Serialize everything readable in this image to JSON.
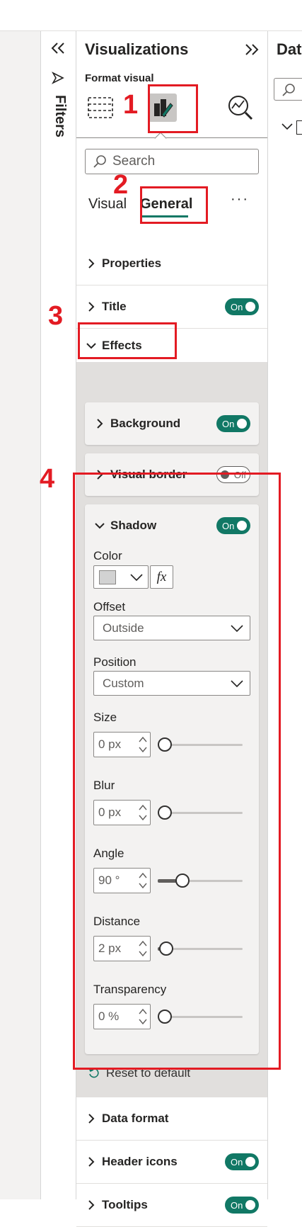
{
  "filters": {
    "label": "Filters",
    "collapse_icon": "double-chevron-left-icon",
    "filter_icon": "filter-icon"
  },
  "visualizations": {
    "title": "Visualizations",
    "expand_icon": "double-chevron-right-icon",
    "subtitle": "Format visual",
    "search_placeholder": "Search",
    "tabs": [
      {
        "label": "Visual"
      },
      {
        "label": "General"
      }
    ],
    "more_icon": "ellipsis-icon",
    "sections": {
      "properties": "Properties",
      "title": "Title",
      "effects": "Effects",
      "data_format": "Data format",
      "header_icons": "Header icons",
      "tooltips": "Tooltips"
    },
    "cards": {
      "background": "Background",
      "visual_border": "Visual border",
      "shadow": "Shadow"
    },
    "toggle_on": "On",
    "toggle_off": "Off",
    "shadow": {
      "color_label": "Color",
      "fx_label": "fx",
      "swatch_color": "#d2d2d2",
      "offset_label": "Offset",
      "offset_value": "Outside",
      "position_label": "Position",
      "position_value": "Custom",
      "size_label": "Size",
      "size_value": "0 px",
      "size_level": 0,
      "blur_label": "Blur",
      "blur_value": "0 px",
      "blur_level": 0,
      "angle_label": "Angle",
      "angle_value": "90 °",
      "angle_level": 0.25,
      "distance_label": "Distance",
      "distance_value": "2 px",
      "distance_level": 0.02,
      "transparency_label": "Transparency",
      "transparency_value": "0 %",
      "transparency_level": 0
    },
    "reset_label": "Reset to default"
  },
  "data_pane": {
    "title_fragment": "Dat"
  },
  "annotations": [
    "1",
    "2",
    "3",
    "4"
  ],
  "colors": {
    "accent": "#117865",
    "annotation": "#e31b23",
    "selected_tab_underline": "#117865"
  }
}
